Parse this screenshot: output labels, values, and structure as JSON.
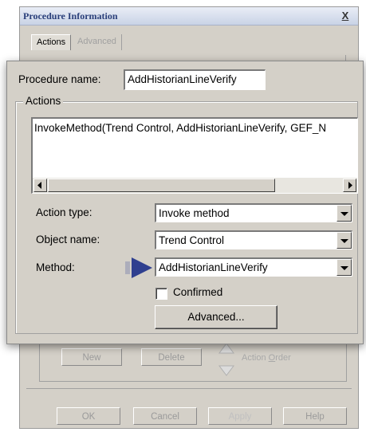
{
  "window": {
    "title": "Procedure Information",
    "close_label": "X"
  },
  "tabs": [
    {
      "label": "Actions"
    },
    {
      "label": "Advanced"
    }
  ],
  "procedure": {
    "name_label": "Procedure name:",
    "name_value": "AddHistorianLineVerify"
  },
  "actions_group": {
    "label": "Actions",
    "list_items": [
      "InvokeMethod(Trend Control, AddHistorianLineVerify, GEF_N"
    ]
  },
  "action_type": {
    "label": "Action type:",
    "value": "Invoke method"
  },
  "object_name": {
    "label": "Object name:",
    "value": "Trend Control"
  },
  "method": {
    "label": "Method:",
    "value": "AddHistorianLineVerify"
  },
  "confirmed": {
    "label": "Confirmed",
    "checked": false
  },
  "advanced_button": {
    "label": "Advanced..."
  },
  "background_buttons": {
    "new": "New",
    "delete": "Delete",
    "action_order_prefix": "Action ",
    "action_order_accel": "O",
    "action_order_suffix": "rder"
  },
  "dialog_buttons": {
    "ok": "OK",
    "cancel": "Cancel",
    "apply": "Apply",
    "help": "Help"
  },
  "colors": {
    "pointer_arrow": "#2f3f8f"
  }
}
